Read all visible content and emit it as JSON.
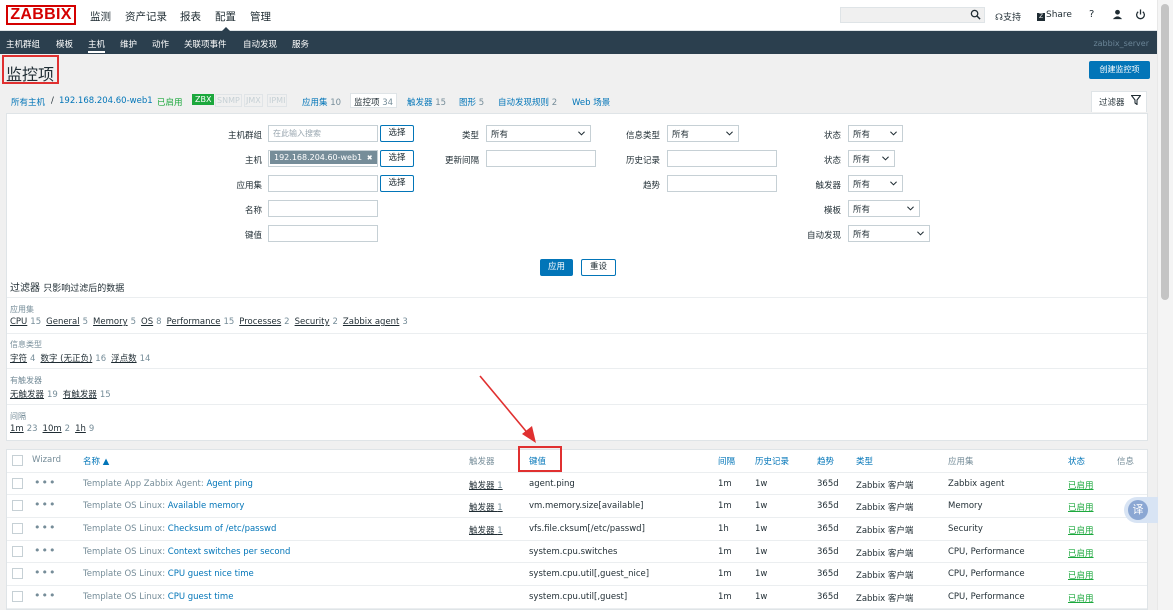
{
  "logo": "ZABBIX",
  "main_menu": [
    "监测",
    "资产记录",
    "报表",
    "配置",
    "管理"
  ],
  "top_right": {
    "support": "支持",
    "share": "Share",
    "help": "?"
  },
  "sub_menu": [
    "主机群组",
    "模板",
    "主机",
    "维护",
    "动作",
    "关联项事件",
    "自动发现",
    "服务"
  ],
  "server_name": "zabbix_server",
  "page_title": "监控项",
  "create_button": "创建监控项",
  "host_nav": {
    "all_hosts": "所有主机",
    "sep": "/",
    "host": "192.168.204.60-web1",
    "enabled": "已启用",
    "zbx": "ZBX",
    "snmp": "SNMP",
    "jmx": "JMX",
    "ipmi": "IPMI",
    "apps": "应用集",
    "apps_count": "10",
    "items": "监控项",
    "items_count": "34",
    "triggers": "触发器",
    "triggers_count": "15",
    "graphs": "图形",
    "graphs_count": "5",
    "discovery": "自动发现规则",
    "discovery_count": "2",
    "web": "Web 场景"
  },
  "filter_tab": "过滤器",
  "filter": {
    "host_group_label": "主机群组",
    "host_group_placeholder": "在此输入搜索",
    "select": "选择",
    "host_label": "主机",
    "host_chip": "192.168.204.60-web1",
    "chip_remove": "✖",
    "app_label": "应用集",
    "name_label": "名称",
    "key_label": "键值",
    "type_label": "类型",
    "type_value": "所有",
    "interval_label": "更新间隔",
    "info_type_label": "信息类型",
    "info_type_value": "所有",
    "history_label": "历史记录",
    "trends_label": "趋势",
    "state_label": "状态",
    "state_value": "所有",
    "status_label": "状态",
    "status_value": "所有",
    "triggers_label": "触发器",
    "triggers_value": "所有",
    "template_label": "模板",
    "template_value": "所有",
    "discovered_label": "自动发现",
    "discovered_value": "所有",
    "apply": "应用",
    "reset": "重设"
  },
  "subfilter": {
    "title": "过滤器",
    "subtitle": "只影响过滤后的数据",
    "groups": [
      {
        "label": "应用集",
        "items": [
          [
            "CPU",
            "15"
          ],
          [
            "General",
            "5"
          ],
          [
            "Memory",
            "5"
          ],
          [
            "OS",
            "8"
          ],
          [
            "Performance",
            "15"
          ],
          [
            "Processes",
            "2"
          ],
          [
            "Security",
            "2"
          ],
          [
            "Zabbix agent",
            "3"
          ]
        ]
      },
      {
        "label": "信息类型",
        "items": [
          [
            "字符",
            "4"
          ],
          [
            "数字 (无正负)",
            "16"
          ],
          [
            "浮点数",
            "14"
          ]
        ]
      },
      {
        "label": "有触发器",
        "items": [
          [
            "无触发器",
            "19"
          ],
          [
            "有触发器",
            "15"
          ]
        ]
      },
      {
        "label": "间隔",
        "items": [
          [
            "1m",
            "23"
          ],
          [
            "10m",
            "2"
          ],
          [
            "1h",
            "9"
          ]
        ]
      }
    ]
  },
  "table": {
    "headers": {
      "wizard": "Wizard",
      "name": "名称 ▲",
      "triggers": "触发器",
      "key": "键值",
      "interval": "间隔",
      "history": "历史记录",
      "trends": "趋势",
      "type": "类型",
      "applications": "应用集",
      "status": "状态",
      "info": "信息"
    },
    "rows": [
      {
        "template": "Template App Zabbix Agent",
        "name": "Agent ping",
        "triggers": "触发器",
        "triggers_count": "1",
        "key": "agent.ping",
        "interval": "1m",
        "history": "1w",
        "trends": "365d",
        "type": "Zabbix 客户端",
        "applications": "Zabbix agent",
        "status": "已启用"
      },
      {
        "template": "Template OS Linux",
        "name": "Available memory",
        "triggers": "触发器",
        "triggers_count": "1",
        "key": "vm.memory.size[available]",
        "interval": "1m",
        "history": "1w",
        "trends": "365d",
        "type": "Zabbix 客户端",
        "applications": "Memory",
        "status": "已启用"
      },
      {
        "template": "Template OS Linux",
        "name": "Checksum of /etc/passwd",
        "triggers": "触发器",
        "triggers_count": "1",
        "key": "vfs.file.cksum[/etc/passwd]",
        "interval": "1h",
        "history": "1w",
        "trends": "365d",
        "type": "Zabbix 客户端",
        "applications": "Security",
        "status": "已启用"
      },
      {
        "template": "Template OS Linux",
        "name": "Context switches per second",
        "triggers": "",
        "triggers_count": "",
        "key": "system.cpu.switches",
        "interval": "1m",
        "history": "1w",
        "trends": "365d",
        "type": "Zabbix 客户端",
        "applications": "CPU, Performance",
        "status": "已启用"
      },
      {
        "template": "Template OS Linux",
        "name": "CPU guest nice time",
        "triggers": "",
        "triggers_count": "",
        "key": "system.cpu.util[,guest_nice]",
        "interval": "1m",
        "history": "1w",
        "trends": "365d",
        "type": "Zabbix 客户端",
        "applications": "CPU, Performance",
        "status": "已启用"
      },
      {
        "template": "Template OS Linux",
        "name": "CPU guest time",
        "triggers": "",
        "triggers_count": "",
        "key": "system.cpu.util[,guest]",
        "interval": "1m",
        "history": "1w",
        "trends": "365d",
        "type": "Zabbix 客户端",
        "applications": "CPU, Performance",
        "status": "已启用"
      }
    ]
  },
  "row_actions": "•••",
  "row_name_sep": ": ",
  "translate_label": "译",
  "colors": {
    "brand": "#d40000",
    "nav": "#2b3f4e",
    "link": "#0275b8",
    "enabled": "#1ca83d",
    "highlight": "#e03030"
  }
}
